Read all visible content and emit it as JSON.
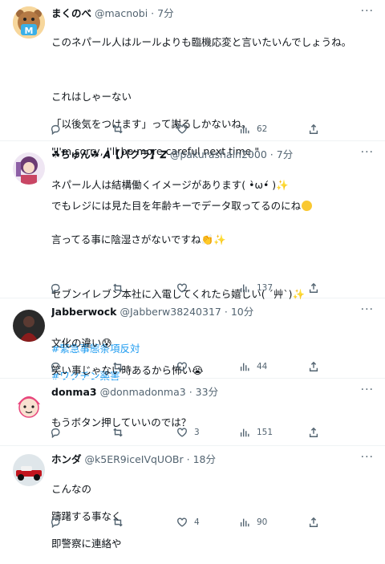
{
  "tweets": [
    {
      "name": "まくのべ",
      "handle": "@macnobi",
      "sep": "·",
      "time": "7分",
      "lines": [
        "このネパール人はルールよりも臨機応変と言いたいんでしょうね。",
        "",
        "これはしゃーない",
        "「以後気をつけます」って謝るしかないね。",
        "\"I'm sorry, I'll be more careful next time.\"",
        "",
        "でもレジには見た目を年齢キーでデータ取ってるのにね"
      ],
      "replies": "",
      "retweets": "",
      "likes": "",
      "views": "62"
    },
    {
      "name": "☘ちゅん☘ 𝑨【パクラ】𝒁",
      "handle": "@pakurashain2000",
      "sep": "·",
      "time": "7分",
      "lines": [
        "ネパール人は結構働くイメージがあります( •̀ω•́ )✨",
        "",
        "言ってる事に陰湿さがないですね👏✨",
        "",
        "セブンイレブン本社に入電してくれたら嬉しい( ´艸`)✨",
        ""
      ],
      "hashtags": [
        "#緊急事態条項反対",
        "#ワクチン薬害"
      ],
      "replies": "",
      "retweets": "",
      "likes": "",
      "views": "137"
    },
    {
      "name": "Jabberwock",
      "handle": "@Jabberw38240317",
      "sep": "·",
      "time": "10分",
      "lines": [
        "文化の違い😰",
        "笑い事じゃない時あるから怖い😭"
      ],
      "replies": "",
      "retweets": "",
      "likes": "",
      "views": "44"
    },
    {
      "name": "donma3",
      "handle": "@donmadonma3",
      "sep": "·",
      "time": "33分",
      "lines": [
        "もうボタン押していいのでは？"
      ],
      "replies": "",
      "retweets": "",
      "likes": "3",
      "views": "151"
    },
    {
      "name": "ホンダ",
      "handle": "@k5ER9iceIVqUOBr",
      "sep": "·",
      "time": "18分",
      "lines": [
        "こんなの",
        "躊躇する事なく",
        "即警察に連絡や"
      ],
      "replies": "",
      "retweets": "",
      "likes": "4",
      "views": "90"
    }
  ],
  "colors": {
    "link": "#1d9bf0",
    "muted": "#536471",
    "text": "#0f1419"
  },
  "icons": {
    "reply": "reply-icon",
    "retweet": "retweet-icon",
    "like": "like-icon",
    "views": "views-icon",
    "share": "share-icon",
    "more": "more-icon"
  }
}
